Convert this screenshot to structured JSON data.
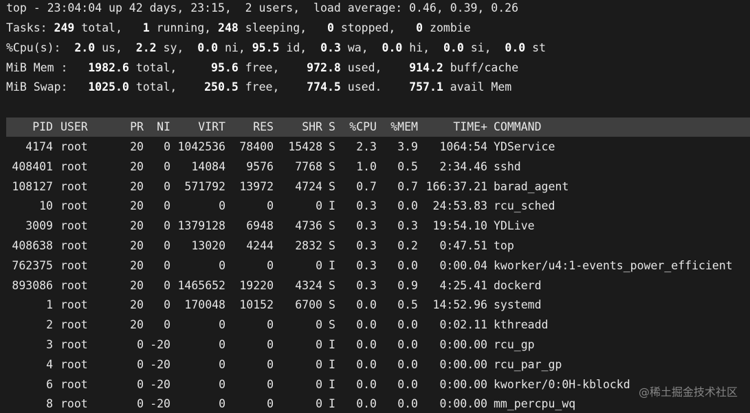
{
  "summary": {
    "top_line": "top - 23:04:04 up 42 days, 23:15,  2 users,  load average: 0.46, 0.39, 0.26",
    "tasks": {
      "label": "Tasks:",
      "total": "249",
      "total_label": "total,",
      "running": "1",
      "running_label": "running,",
      "sleeping": "248",
      "sleeping_label": "sleeping,",
      "stopped": "0",
      "stopped_label": "stopped,",
      "zombie": "0",
      "zombie_label": "zombie"
    },
    "cpu": {
      "label": "%Cpu(s):",
      "us": "2.0",
      "us_label": "us,",
      "sy": "2.2",
      "sy_label": "sy,",
      "ni": "0.0",
      "ni_label": "ni,",
      "id": "95.5",
      "id_label": "id,",
      "wa": "0.3",
      "wa_label": "wa,",
      "hi": "0.0",
      "hi_label": "hi,",
      "si": "0.0",
      "si_label": "si,",
      "st": "0.0",
      "st_label": "st"
    },
    "mem": {
      "label": "MiB Mem :",
      "total": "1982.6",
      "total_label": "total,",
      "free": "95.6",
      "free_label": "free,",
      "used": "972.8",
      "used_label": "used,",
      "buff": "914.2",
      "buff_label": "buff/cache"
    },
    "swap": {
      "label": "MiB Swap:",
      "total": "1025.0",
      "total_label": "total,",
      "free": "250.5",
      "free_label": "free,",
      "used": "774.5",
      "used_label": "used.",
      "avail": "757.1",
      "avail_label": "avail Mem"
    }
  },
  "columns": [
    "PID",
    "USER",
    "PR",
    "NI",
    "VIRT",
    "RES",
    "SHR",
    "S",
    "%CPU",
    "%MEM",
    "TIME+",
    "COMMAND"
  ],
  "processes": [
    [
      "4174",
      "root",
      "20",
      "0",
      "1042536",
      "78400",
      "15428",
      "S",
      "2.3",
      "3.9",
      "1064:54",
      "YDService"
    ],
    [
      "408401",
      "root",
      "20",
      "0",
      "14084",
      "9576",
      "7768",
      "S",
      "1.0",
      "0.5",
      "2:34.46",
      "sshd"
    ],
    [
      "108127",
      "root",
      "20",
      "0",
      "571792",
      "13972",
      "4724",
      "S",
      "0.7",
      "0.7",
      "166:37.21",
      "barad_agent"
    ],
    [
      "10",
      "root",
      "20",
      "0",
      "0",
      "0",
      "0",
      "I",
      "0.3",
      "0.0",
      "24:53.83",
      "rcu_sched"
    ],
    [
      "3009",
      "root",
      "20",
      "0",
      "1379128",
      "6948",
      "4736",
      "S",
      "0.3",
      "0.3",
      "19:54.10",
      "YDLive"
    ],
    [
      "408638",
      "root",
      "20",
      "0",
      "13020",
      "4244",
      "2832",
      "S",
      "0.3",
      "0.2",
      "0:47.51",
      "top"
    ],
    [
      "762375",
      "root",
      "20",
      "0",
      "0",
      "0",
      "0",
      "I",
      "0.3",
      "0.0",
      "0:00.04",
      "kworker/u4:1-events_power_efficient"
    ],
    [
      "893086",
      "root",
      "20",
      "0",
      "1465652",
      "19220",
      "4324",
      "S",
      "0.3",
      "0.9",
      "4:25.41",
      "dockerd"
    ],
    [
      "1",
      "root",
      "20",
      "0",
      "170048",
      "10152",
      "6700",
      "S",
      "0.0",
      "0.5",
      "14:52.96",
      "systemd"
    ],
    [
      "2",
      "root",
      "20",
      "0",
      "0",
      "0",
      "0",
      "S",
      "0.0",
      "0.0",
      "0:02.11",
      "kthreadd"
    ],
    [
      "3",
      "root",
      "0",
      "-20",
      "0",
      "0",
      "0",
      "I",
      "0.0",
      "0.0",
      "0:00.00",
      "rcu_gp"
    ],
    [
      "4",
      "root",
      "0",
      "-20",
      "0",
      "0",
      "0",
      "I",
      "0.0",
      "0.0",
      "0:00.00",
      "rcu_par_gp"
    ],
    [
      "6",
      "root",
      "0",
      "-20",
      "0",
      "0",
      "0",
      "I",
      "0.0",
      "0.0",
      "0:00.00",
      "kworker/0:0H-kblockd"
    ],
    [
      "8",
      "root",
      "0",
      "-20",
      "0",
      "0",
      "0",
      "I",
      "0.0",
      "0.0",
      "0:00.00",
      "mm_percpu_wq"
    ]
  ],
  "watermark": "@稀土掘金技术社区"
}
